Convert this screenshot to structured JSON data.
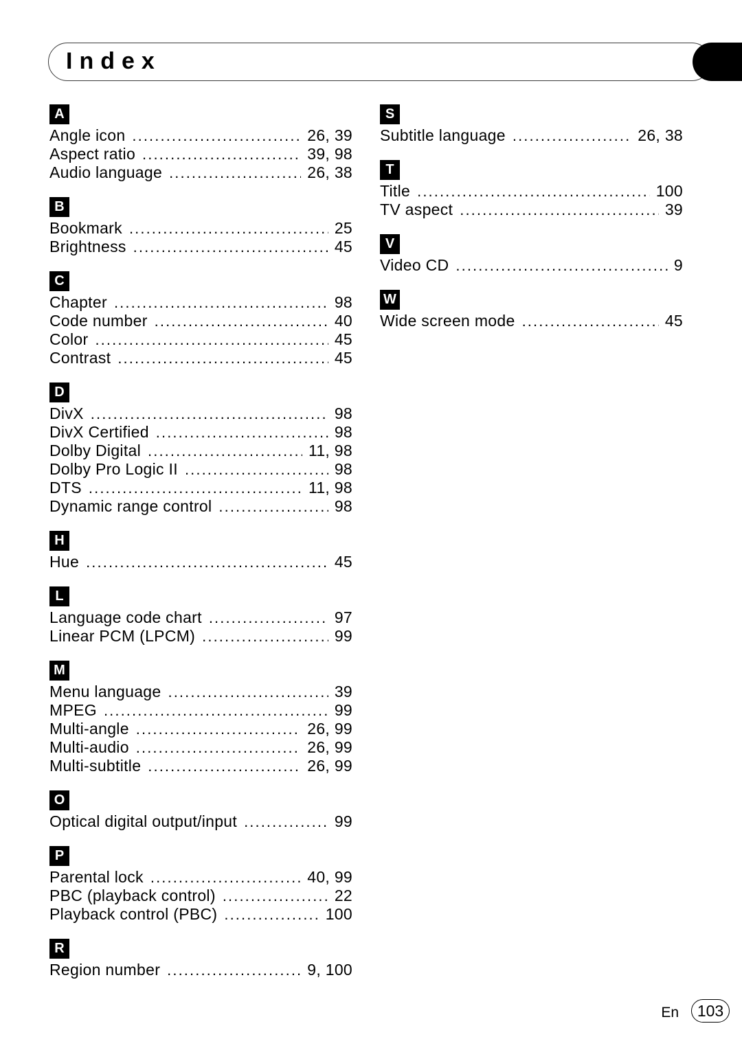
{
  "header": {
    "title": "Index",
    "tab_color": "#000000"
  },
  "footer": {
    "language": "En",
    "page_number": "103"
  },
  "columns": [
    {
      "name": "left",
      "sections": [
        {
          "letter": "A",
          "entries": [
            {
              "term": "Angle icon",
              "pages": "26, 39"
            },
            {
              "term": "Aspect ratio",
              "pages": "39, 98"
            },
            {
              "term": "Audio language",
              "pages": "26, 38"
            }
          ]
        },
        {
          "letter": "B",
          "entries": [
            {
              "term": "Bookmark",
              "pages": "25"
            },
            {
              "term": "Brightness",
              "pages": "45"
            }
          ]
        },
        {
          "letter": "C",
          "entries": [
            {
              "term": "Chapter",
              "pages": "98"
            },
            {
              "term": "Code number",
              "pages": "40"
            },
            {
              "term": "Color",
              "pages": "45"
            },
            {
              "term": "Contrast",
              "pages": "45"
            }
          ]
        },
        {
          "letter": "D",
          "entries": [
            {
              "term": "DivX",
              "pages": "98"
            },
            {
              "term": "DivX Certified",
              "pages": "98"
            },
            {
              "term": "Dolby Digital",
              "pages": "11, 98"
            },
            {
              "term": "Dolby Pro Logic II",
              "pages": "98"
            },
            {
              "term": "DTS",
              "pages": "11, 98"
            },
            {
              "term": "Dynamic range control",
              "pages": "98"
            }
          ]
        },
        {
          "letter": "H",
          "entries": [
            {
              "term": "Hue",
              "pages": "45"
            }
          ]
        },
        {
          "letter": "L",
          "entries": [
            {
              "term": "Language code chart",
              "pages": "97"
            },
            {
              "term": "Linear PCM (LPCM)",
              "pages": "99"
            }
          ]
        },
        {
          "letter": "M",
          "entries": [
            {
              "term": "Menu language",
              "pages": "39"
            },
            {
              "term": "MPEG",
              "pages": "99"
            },
            {
              "term": "Multi-angle",
              "pages": "26, 99"
            },
            {
              "term": "Multi-audio",
              "pages": "26, 99"
            },
            {
              "term": "Multi-subtitle",
              "pages": "26, 99"
            }
          ]
        },
        {
          "letter": "O",
          "entries": [
            {
              "term": "Optical digital output/input",
              "pages": "99"
            }
          ]
        },
        {
          "letter": "P",
          "entries": [
            {
              "term": "Parental lock",
              "pages": "40, 99"
            },
            {
              "term": "PBC (playback control)",
              "pages": "22"
            },
            {
              "term": "Playback control (PBC)",
              "pages": "100"
            }
          ]
        },
        {
          "letter": "R",
          "entries": [
            {
              "term": "Region number",
              "pages": "9, 100"
            }
          ]
        }
      ]
    },
    {
      "name": "right",
      "sections": [
        {
          "letter": "S",
          "entries": [
            {
              "term": "Subtitle language",
              "pages": "26, 38"
            }
          ]
        },
        {
          "letter": "T",
          "entries": [
            {
              "term": "Title",
              "pages": "100"
            },
            {
              "term": "TV aspect",
              "pages": "39"
            }
          ]
        },
        {
          "letter": "V",
          "entries": [
            {
              "term": "Video CD",
              "pages": "9"
            }
          ]
        },
        {
          "letter": "W",
          "entries": [
            {
              "term": "Wide screen mode",
              "pages": "45"
            }
          ]
        }
      ]
    }
  ]
}
